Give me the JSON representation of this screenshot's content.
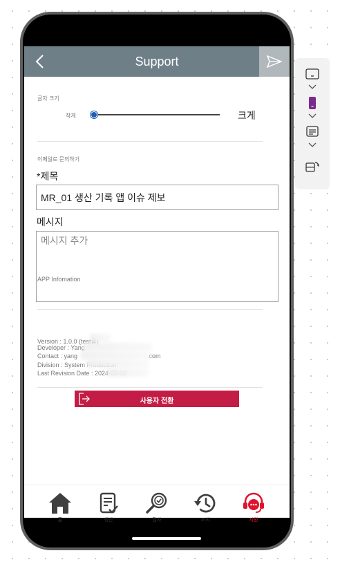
{
  "header": {
    "title": "Support"
  },
  "font_size": {
    "section_label": "글자 크기",
    "small_label": "작게",
    "large_label": "크게",
    "level": 0
  },
  "inquiry": {
    "section_label": "이메일로 문의하기",
    "subject_label": "*제목",
    "subject_value": "MR_01 생산 기록 앱 이슈 제보",
    "message_label": "메시지",
    "message_placeholder": "메시지 추가"
  },
  "app_info": {
    "title": "APP Infomation",
    "version": "Version : 1.0.0 (test용)",
    "developer": "Developer : Yang",
    "contact": "Contact : yang",
    "contact_suffix": ".com",
    "division": "Division : System Production",
    "last_revision": "Last Revision Date : 2024-05-06"
  },
  "switch_user_button": {
    "label": "사용자 전환"
  },
  "bottom_nav": [
    {
      "label": "홈",
      "icon": "home-icon"
    },
    {
      "label": "생산",
      "icon": "clipboard-check-icon"
    },
    {
      "label": "검사",
      "icon": "inspect-magnifier-icon"
    },
    {
      "label": "조회",
      "icon": "history-icon"
    },
    {
      "label": "지원",
      "icon": "support-headset-icon",
      "active": true
    }
  ],
  "colors": {
    "app_bar": "#6e7f88",
    "send_button": "#b0b8bc",
    "switch_button": "#c41d45",
    "active_nav": "#e0142c",
    "slider_thumb": "#1e5fb4"
  }
}
